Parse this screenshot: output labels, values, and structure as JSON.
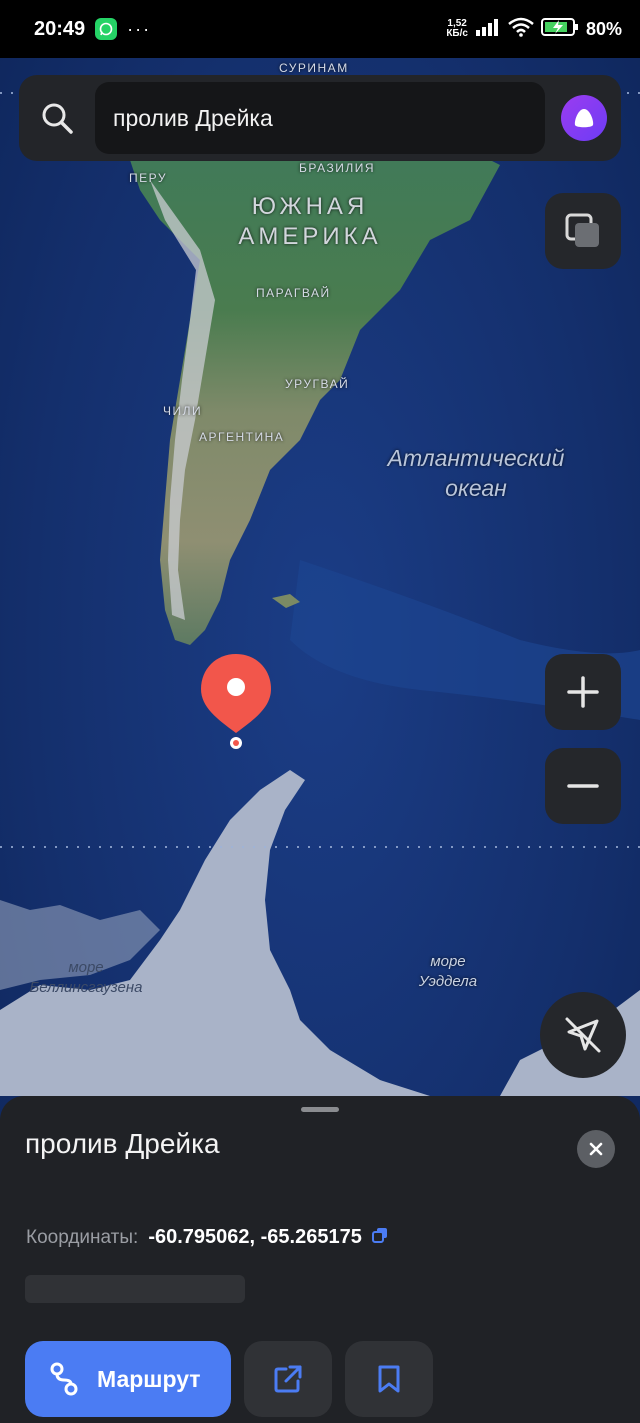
{
  "status_bar": {
    "time": "20:49",
    "net_speed_value": "1,52",
    "net_speed_unit": "КБ/с",
    "battery_percent": "80%",
    "overflow_dots": "···"
  },
  "search": {
    "query": "пролив Дрейка"
  },
  "map": {
    "labels": {
      "suriname": "СУРИНАМ",
      "peru": "ПЕРУ",
      "brazil": "БРАЗИЛИЯ",
      "continent_line1": "ЮЖНАЯ",
      "continent_line2": "АМЕРИКА",
      "paraguay": "ПАРАГВАЙ",
      "uruguay": "УРУГВАЙ",
      "chile": "ЧИЛИ",
      "argentina": "АРГЕНТИНА",
      "ocean_line1": "Атлантический",
      "ocean_line2": "океан",
      "sea_bell_line1": "море",
      "sea_bell_line2": "Беллинсгаузена",
      "sea_wed_line1": "море",
      "sea_wed_line2": "Уэддела"
    },
    "selected_point": {
      "lat": -60.795062,
      "lon": -65.265175
    }
  },
  "controls": {
    "layers_icon": "layers-icon",
    "zoom_in_icon": "plus-icon",
    "zoom_out_icon": "minus-icon",
    "navigation_icon": "navigation-off-icon"
  },
  "sheet": {
    "title": "пролив Дрейка",
    "coords_label": "Координаты:",
    "coords_value": "-60.795062, -65.265175",
    "route_label": "Маршрут"
  },
  "colors": {
    "accent_blue": "#4b7cf3",
    "pin_red": "#f2564b",
    "sheet_bg": "#202226",
    "alice_purple": "#8a3cf3"
  }
}
